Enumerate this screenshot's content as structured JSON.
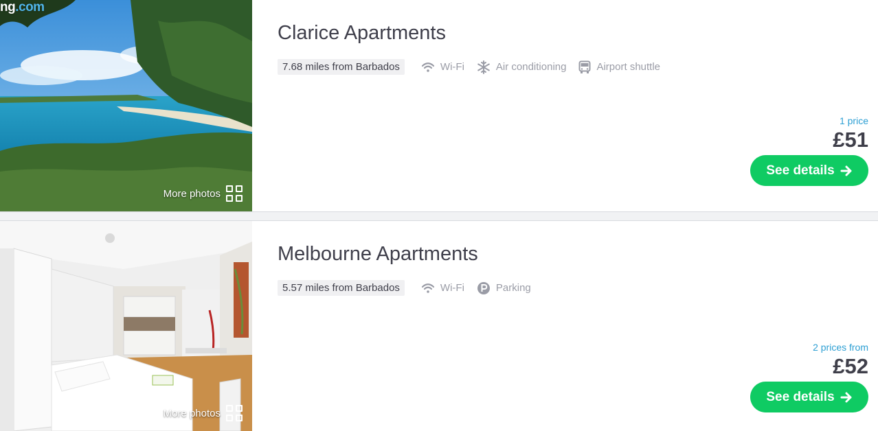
{
  "listings": [
    {
      "brand_visible": "ng",
      "brand_suffix": ".com",
      "more_photos": "More photos",
      "title": "Clarice Apartments",
      "distance": "7.68 miles from Barbados",
      "amenities": [
        {
          "icon": "wifi-icon",
          "label": "Wi-Fi"
        },
        {
          "icon": "snowflake-icon",
          "label": "Air conditioning"
        },
        {
          "icon": "bus-icon",
          "label": "Airport shuttle"
        }
      ],
      "price_count": "1 price",
      "price": "£51",
      "button": "See details",
      "button_icon": "arrow-right-icon"
    },
    {
      "more_photos": "More photos",
      "title": "Melbourne Apartments",
      "distance": "5.57 miles from Barbados",
      "amenities": [
        {
          "icon": "wifi-icon",
          "label": "Wi-Fi"
        },
        {
          "icon": "parking-icon",
          "label": "Parking"
        }
      ],
      "price_count": "2 prices from",
      "price": "£52",
      "button": "See details",
      "button_icon": "arrow-right-icon"
    }
  ],
  "colors": {
    "accent_green": "#0fcb63",
    "price_count_blue": "#2d9fd3",
    "text_dark": "#3e3e4a",
    "amenity_gray": "#9a9ca6"
  }
}
